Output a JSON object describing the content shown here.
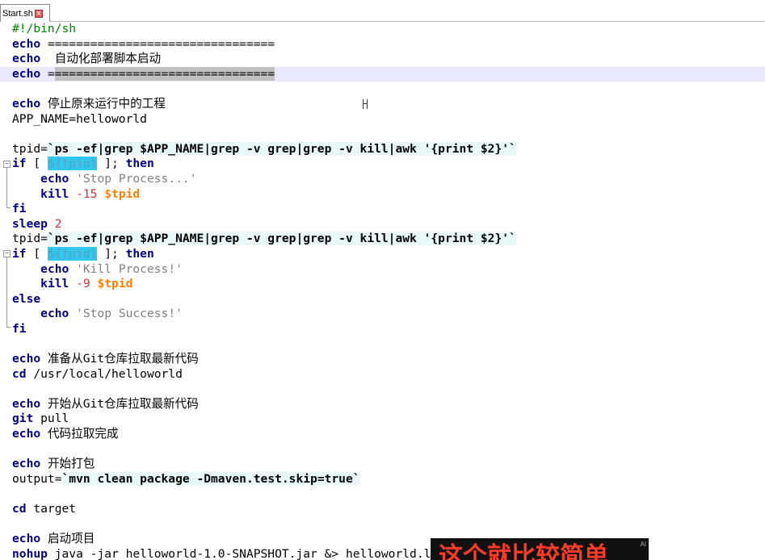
{
  "tab": {
    "label": "Start.sh"
  },
  "subtitle": {
    "text": "这个就比较简单",
    "badge": "AI"
  },
  "code": {
    "l1": "#!/bin/sh",
    "l2_kw": "echo",
    "l2_rest": " ================================",
    "l3_kw": "echo",
    "l3_rest": "  自动化部署脚本启动",
    "l4_kw": "echo",
    "l4_a": " =",
    "l4_sel": "===============================",
    "l6_kw": "echo",
    "l6_rest": " 停止原来运行中的工程",
    "l7": "APP_NAME=helloworld",
    "l9_a": "tpid=",
    "l9_bt": "`ps -ef|grep $APP_NAME|grep -v grep|grep -v kill|awk '{print $2}'`",
    "l10_kw": "if",
    "l10_a": " [ ",
    "l10_brace": "${tpid}",
    "l10_b": " ]; ",
    "l10_then": "then",
    "l11_kw": "echo",
    "l11_str": " 'Stop Process...'",
    "l12_kw": "kill",
    "l12_num": " -15",
    "l12_var": "$tpid",
    "l13_kw": "fi",
    "l14_kw": "sleep",
    "l14_num": " 2",
    "l15_a": "tpid=",
    "l15_bt": "`ps -ef|grep $APP_NAME|grep -v grep|grep -v kill|awk '{print $2}'`",
    "l16_kw": "if",
    "l16_a": " [ ",
    "l16_brace": "${tpid}",
    "l16_b": " ]; ",
    "l16_then": "then",
    "l17_kw": "echo",
    "l17_str": " 'Kill Process!'",
    "l18_kw": "kill",
    "l18_num": " -9",
    "l18_var": "$tpid",
    "l19_kw": "else",
    "l20_kw": "echo",
    "l20_str": " 'Stop Success!'",
    "l21_kw": "fi",
    "l23_kw": "echo",
    "l23_rest": " 准备从Git仓库拉取最新代码",
    "l24_kw": "cd",
    "l24_rest": " /usr/local/helloworld",
    "l26_kw": "echo",
    "l26_rest": " 开始从Git仓库拉取最新代码",
    "l27_kw": "git",
    "l27_rest": " pull",
    "l28_kw": "echo",
    "l28_rest": " 代码拉取完成",
    "l30_kw": "echo",
    "l30_rest": " 开始打包",
    "l31_a": "output=",
    "l31_bt": "`mvn clean package -Dmaven.test.skip=true`",
    "l33_kw": "cd",
    "l33_rest": " target",
    "l35_kw": "echo",
    "l35_rest": " 启动项目",
    "l36_kw": "nohup",
    "l36_rest": " java -jar helloworld-1.0-SNAPSHOT.jar &> helloworld.log &"
  }
}
